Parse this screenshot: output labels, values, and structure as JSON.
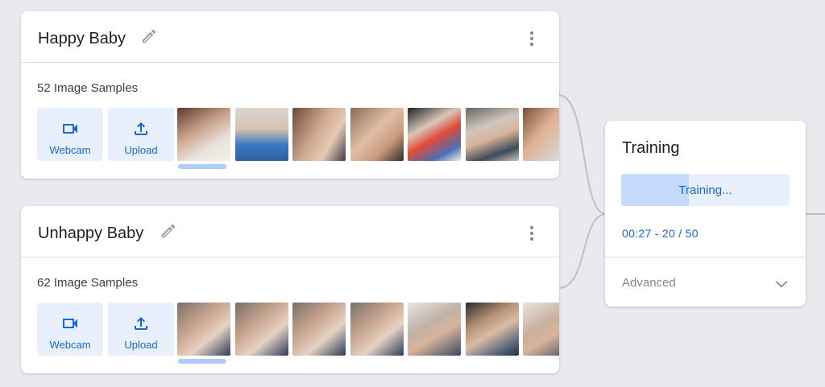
{
  "classes": [
    {
      "name": "Happy Baby",
      "samples_label": "52 Image Samples",
      "webcam_label": "Webcam",
      "upload_label": "Upload",
      "thumbnails": [
        "baby-thumbnail-1",
        "baby-thumbnail-2",
        "baby-thumbnail-3",
        "baby-thumbnail-4",
        "baby-thumbnail-5",
        "baby-thumbnail-6",
        "baby-thumbnail-7"
      ]
    },
    {
      "name": "Unhappy Baby",
      "samples_label": "62 Image Samples",
      "webcam_label": "Webcam",
      "upload_label": "Upload",
      "thumbnails": [
        "baby-thumbnail-1",
        "baby-thumbnail-2",
        "baby-thumbnail-3",
        "baby-thumbnail-4",
        "baby-thumbnail-5",
        "baby-thumbnail-6",
        "baby-thumbnail-7"
      ]
    }
  ],
  "training": {
    "title": "Training",
    "button_label": "Training...",
    "progress": 0.4,
    "status": "00:27 - 20 / 50",
    "advanced_label": "Advanced"
  },
  "icons": {
    "edit": "pencil-icon",
    "more": "more-vert-icon",
    "webcam": "videocam-icon",
    "upload": "upload-icon",
    "advanced": "chevron-down-icon"
  },
  "colors": {
    "accent": "#1967d2",
    "button_bg": "#e8f0fe",
    "progress_fill": "#c6dafc",
    "scroll_indicator": "#aecbfa",
    "background": "#e8eaed"
  }
}
